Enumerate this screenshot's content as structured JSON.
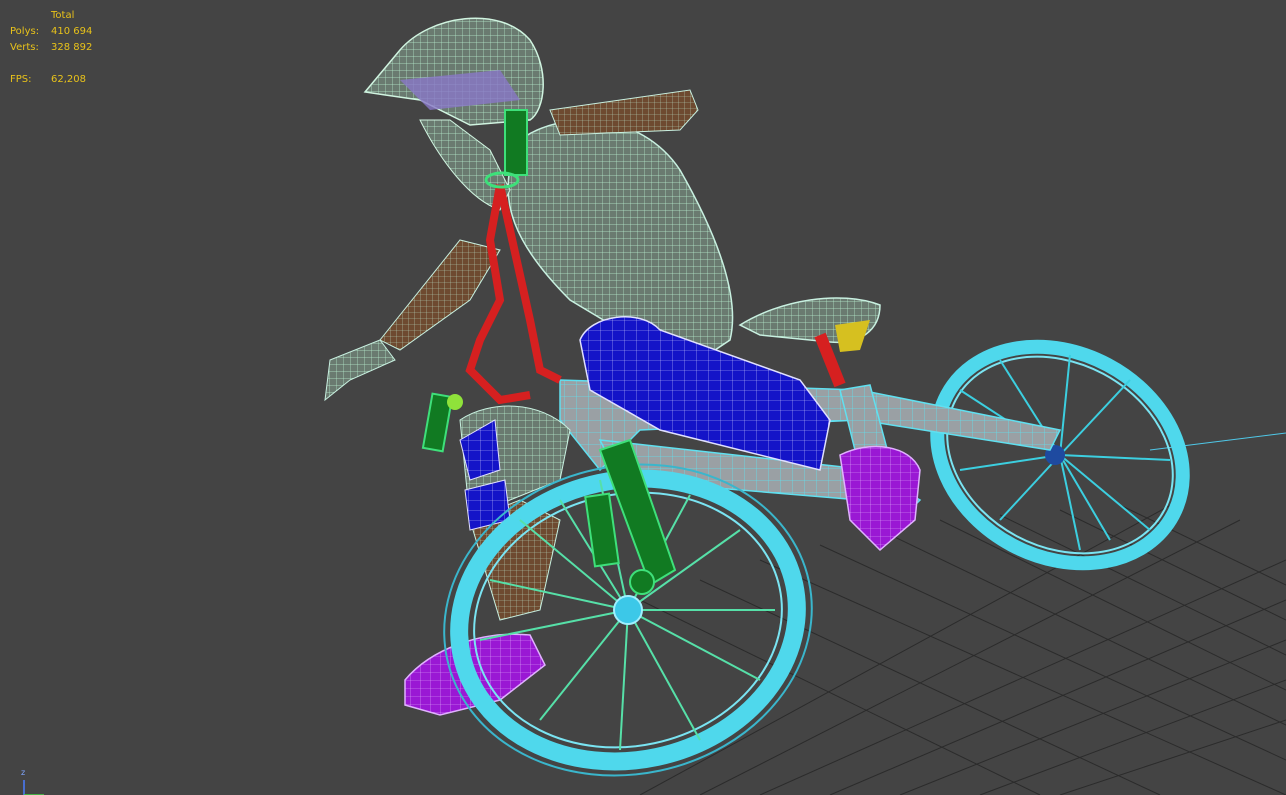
{
  "stats": {
    "header": "Total",
    "polys_label": "Polys:",
    "polys_value": "410 694",
    "verts_label": "Verts:",
    "verts_value": "328 892",
    "fps_label": "FPS:",
    "fps_value": "62,208"
  },
  "gizmo": {
    "z_label": "z"
  },
  "colors": {
    "viewport_bg": "#444444",
    "stats_text": "#e8c21a",
    "grid": "#2a2a2a",
    "wheel_wire": "#4fd8ec",
    "spoke": "#56e0a8",
    "frame": "#c8c8c8",
    "helmet": "#a8e6c8",
    "skin": "#7a5236",
    "red_part": "#d62020",
    "blue_part": "#1a1ad0",
    "purple_part": "#a01ad8",
    "green_fork": "#117a22"
  },
  "scene_objects": [
    "rider-body",
    "rider-helmet",
    "front-wheel",
    "rear-wheel",
    "bike-frame",
    "handlebar",
    "front-fork",
    "seat",
    "knee-pad",
    "shoe",
    "ground-grid"
  ]
}
